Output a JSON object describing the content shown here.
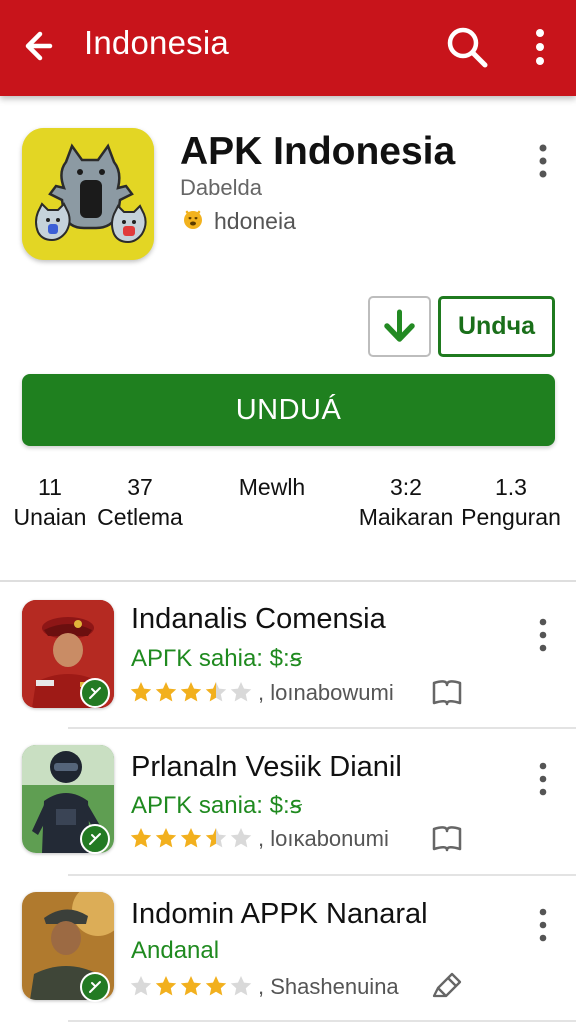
{
  "appbar": {
    "title": "Indonesia",
    "back_icon": "arrow-left-icon",
    "search_icon": "search-icon",
    "more_icon": "more-vertical-icon",
    "color": "#c8141b"
  },
  "app": {
    "name": "APK Indonesia",
    "developer": "Dabelda",
    "category": "hdoneia",
    "icon_background": "#e3d624"
  },
  "actions": {
    "secondary_button_label": "Undчa",
    "primary_button_label": "UNDUÁ",
    "accent": "#1f801f"
  },
  "stats": [
    {
      "value": "11",
      "label": "Unaian"
    },
    {
      "value": "37",
      "label": "Cetlema"
    },
    {
      "value": "Mewlh",
      "label": ""
    },
    {
      "value": "3:2",
      "label": "Maikaran"
    },
    {
      "value": "1.3",
      "label": "Penguran"
    }
  ],
  "list": [
    {
      "title": "Indanalis Comensia",
      "subtitle": "APΓK sahia:  $:ꞩ",
      "rating": 3.5,
      "meta": ",  loınabowumi",
      "meta_icon": "bookmark-icon"
    },
    {
      "title": "Prlanaln Vesiik Dianil",
      "subtitle": "APΓK sania:  $:ꞩ",
      "rating": 3.5,
      "meta": ",  loıĸabonumi",
      "meta_icon": "bookmark-icon"
    },
    {
      "title": "Indomin APPK Nanaral",
      "subtitle": "Andanal",
      "rating": 3.5,
      "meta": ",  Shashenuina",
      "meta_icon": "edit-pencil-icon"
    }
  ]
}
